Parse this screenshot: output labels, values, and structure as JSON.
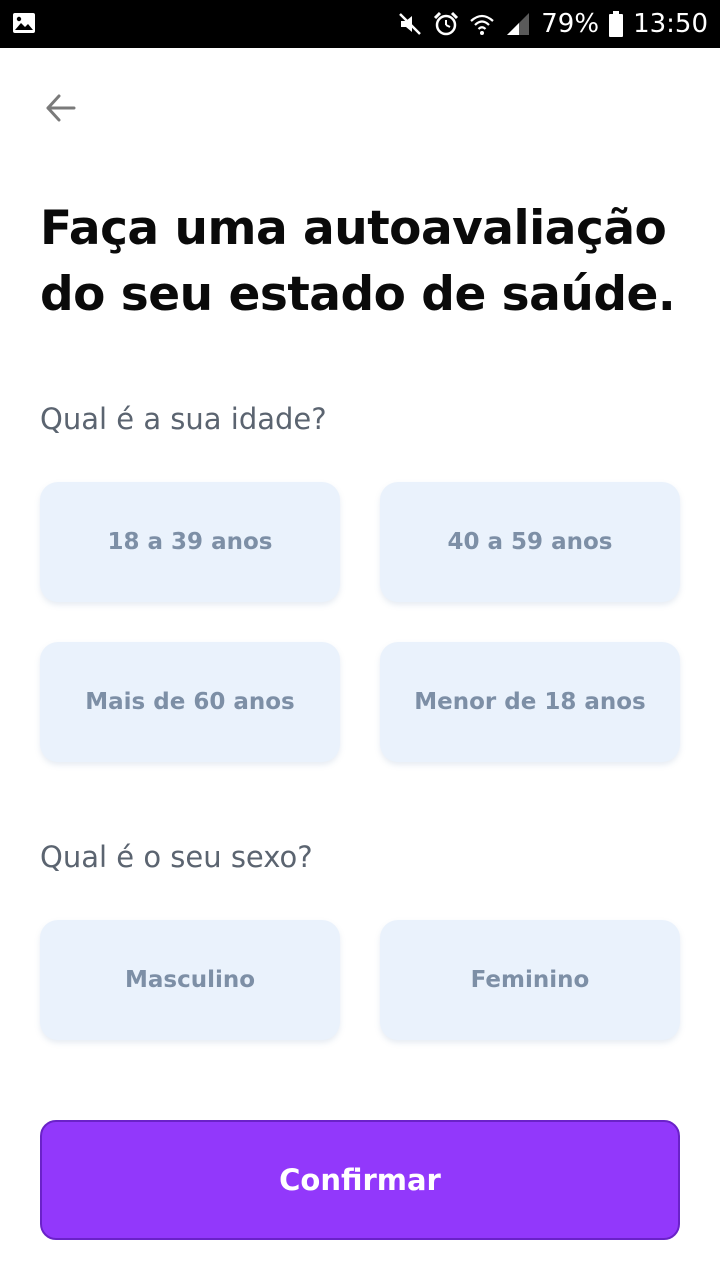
{
  "status_bar": {
    "battery": "79%",
    "time": "13:50",
    "icons": [
      "gallery-icon",
      "mute-icon",
      "alarm-icon",
      "wifi-icon",
      "signal-icon",
      "battery-icon"
    ]
  },
  "header": {
    "back_icon": "arrow-left-icon"
  },
  "page": {
    "title": "Faça uma autoavaliação do seu estado de saúde."
  },
  "age": {
    "question": "Qual é a sua idade?",
    "options": [
      "18 a 39 anos",
      "40 a 59 anos",
      "Mais de 60 anos",
      "Menor de 18 anos"
    ]
  },
  "sex": {
    "question": "Qual é o seu sexo?",
    "options": [
      "Masculino",
      "Feminino"
    ]
  },
  "actions": {
    "confirm_label": "Confirmar"
  },
  "colors": {
    "accent": "#9238fb",
    "option_bg": "#eaf2fc",
    "option_text": "#7d8fa6",
    "question_text": "#5b6470"
  }
}
